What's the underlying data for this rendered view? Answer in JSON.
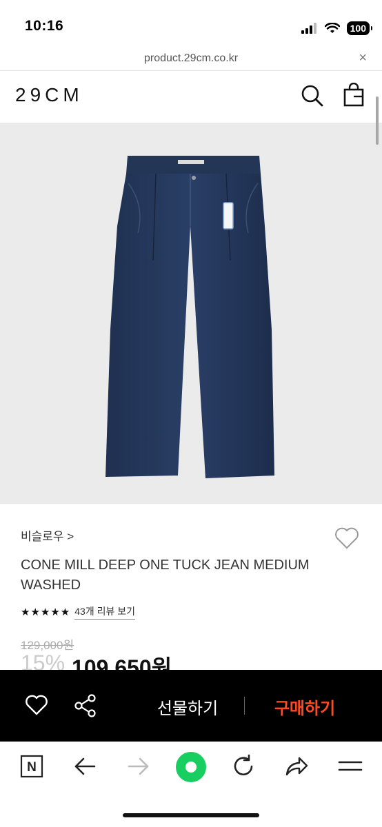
{
  "status_bar": {
    "time": "10:16",
    "battery": "100"
  },
  "browser": {
    "url": "product.29cm.co.kr",
    "close_glyph": "×"
  },
  "site_header": {
    "logo": "29CM",
    "search_icon": "search-icon",
    "bag_icon": "shopping-bag-icon"
  },
  "product": {
    "image_alt": "dark indigo wide one-tuck jeans",
    "brand": "비슬로우 >",
    "name": "CONE MILL DEEP ONE TUCK JEAN MEDIUM WASHED",
    "stars": "★★★★★",
    "review_link": "43개 리뷰 보기",
    "original_price": "129,000원",
    "discount": "15%",
    "sale_price": "109,650원"
  },
  "purchase_bar": {
    "gift_label": "선물하기",
    "buy_label": "구매하기",
    "accent": "#ff4a1f"
  },
  "toolbar": {
    "n_label": "N",
    "icons": [
      "naver-n-icon",
      "back-arrow-icon",
      "forward-arrow-icon",
      "green-dot-icon",
      "reload-icon",
      "share-arrow-icon",
      "menu-icon"
    ],
    "green": "#19ce60"
  }
}
